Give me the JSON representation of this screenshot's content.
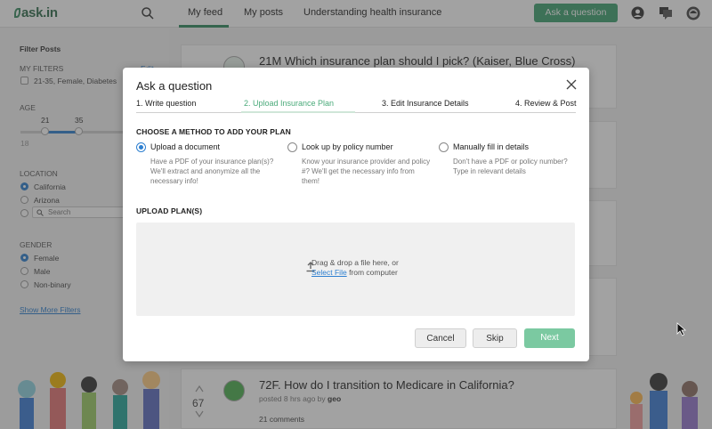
{
  "app": {
    "logo_text": "ask.in",
    "tabs": [
      {
        "label": "My feed",
        "active": true
      },
      {
        "label": "My posts",
        "active": false
      },
      {
        "label": "Understanding health insurance",
        "active": false
      }
    ],
    "ask_button": "Ask a question"
  },
  "sidebar": {
    "title": "Filter Posts",
    "my_filters": {
      "label": "MY FILTERS",
      "edit": "Edit",
      "item": "21-35, Female, Diabetes"
    },
    "age": {
      "label": "AGE",
      "min_value": "21",
      "max_value": "35",
      "scale_min": "18"
    },
    "location": {
      "label": "LOCATION",
      "options": [
        "California",
        "Arizona"
      ],
      "selected": "California",
      "search_placeholder": "Search"
    },
    "gender": {
      "label": "GENDER",
      "options": [
        "Female",
        "Male",
        "Non-binary"
      ],
      "selected": "Female"
    },
    "show_more": "Show More Filters"
  },
  "feed": {
    "post1": {
      "title": "21M Which insurance plan should I pick? (Kaiser, Blue Cross)"
    },
    "post_last": {
      "title": "72F. How do I transition to Medicare in California?",
      "meta_prefix": "posted 8 hrs ago by",
      "author": "geo",
      "votes": "67",
      "comments": "21 comments"
    }
  },
  "modal": {
    "title": "Ask a question",
    "steps": [
      {
        "label": "1. Write question",
        "active": false
      },
      {
        "label": "2. Upload Insurance Plan",
        "active": true
      },
      {
        "label": "3. Edit Insurance Details",
        "active": false
      },
      {
        "label": "4. Review & Post",
        "active": false
      }
    ],
    "method_heading": "CHOOSE A METHOD TO ADD YOUR PLAN",
    "methods": [
      {
        "title": "Upload a document",
        "desc": "Have a PDF of your insurance plan(s)? We'll extract and anonymize all the necessary info!",
        "selected": true
      },
      {
        "title": "Look up by policy number",
        "desc": "Know your insurance provider and policy #? We'll get the necessary info from them!",
        "selected": false
      },
      {
        "title": "Manually fill in details",
        "desc": "Don't have a PDF or policy number? Type in relevant details",
        "selected": false
      }
    ],
    "upload_heading": "UPLOAD PLAN(S)",
    "drop_line1": "Drag & drop a file here, or",
    "drop_link": "Select File",
    "drop_line2_suffix": "from computer",
    "buttons": {
      "cancel": "Cancel",
      "skip": "Skip",
      "next": "Next"
    }
  },
  "colors": {
    "brand_green": "#3ea26f",
    "next_button": "#7bc9a1",
    "active_step": "#4aaa7a",
    "radio_blue": "#2d7fd0"
  }
}
